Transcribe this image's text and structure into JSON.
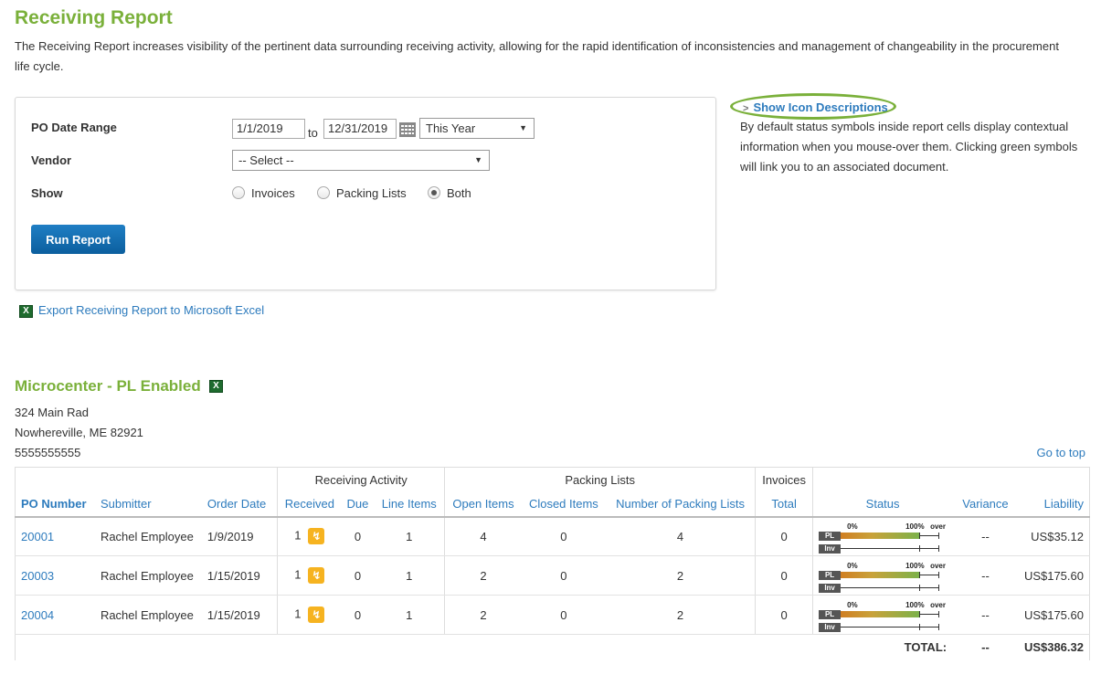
{
  "page": {
    "title": "Receiving Report",
    "description": "The Receiving Report increases visibility of the pertinent data surrounding receiving activity, allowing for the rapid identification of inconsistencies and management of changeability in the procurement life cycle."
  },
  "form": {
    "po_date_label": "PO Date Range",
    "date_from": "1/1/2019",
    "to_label": "to",
    "date_to": "12/31/2019",
    "range_preset": "This Year",
    "vendor_label": "Vendor",
    "vendor_value": "-- Select --",
    "show_label": "Show",
    "show_options": [
      "Invoices",
      "Packing Lists",
      "Both"
    ],
    "show_selected": "Both",
    "run_button": "Run Report"
  },
  "export_label": "Export Receiving Report to Microsoft Excel",
  "icon_help": {
    "link_label": "Show Icon Descriptions",
    "text": "By default status symbols inside report cells display contextual information when you mouse-over them. Clicking green symbols will link you to an associated document.",
    "highlight_color": "#7ab03a"
  },
  "vendor": {
    "name": "Microcenter - PL Enabled",
    "address_line1": "324 Main Rad",
    "address_line2": "Nowhereville, ME 82921",
    "phone": "5555555555",
    "goto_top": "Go to top"
  },
  "table": {
    "groups": {
      "receiving_activity": "Receiving Activity",
      "packing_lists": "Packing Lists",
      "invoices": "Invoices"
    },
    "columns": {
      "po_number": "PO Number",
      "submitter": "Submitter",
      "order_date": "Order Date",
      "received": "Received",
      "due": "Due",
      "line_items": "Line Items",
      "open_items": "Open Items",
      "closed_items": "Closed Items",
      "num_packing_lists": "Number of Packing Lists",
      "total": "Total",
      "status": "Status",
      "variance": "Variance",
      "liability": "Liability"
    },
    "status_bar": {
      "pl_tag": "PL",
      "inv_tag": "Inv",
      "label_0": "0%",
      "label_100": "100%",
      "label_over": "over"
    },
    "rows": [
      {
        "po": "20001",
        "submitter": "Rachel Employee",
        "order_date": "1/9/2019",
        "received": "1",
        "due": "0",
        "line_items": "1",
        "open_items": "4",
        "closed_items": "0",
        "num_pl": "4",
        "invoice_total": "0",
        "pl_progress": 1.0,
        "inv_progress": 0.0,
        "variance": "--",
        "liability": "US$35.12"
      },
      {
        "po": "20003",
        "submitter": "Rachel Employee",
        "order_date": "1/15/2019",
        "received": "1",
        "due": "0",
        "line_items": "1",
        "open_items": "2",
        "closed_items": "0",
        "num_pl": "2",
        "invoice_total": "0",
        "pl_progress": 1.0,
        "inv_progress": 0.0,
        "variance": "--",
        "liability": "US$175.60"
      },
      {
        "po": "20004",
        "submitter": "Rachel Employee",
        "order_date": "1/15/2019",
        "received": "1",
        "due": "0",
        "line_items": "1",
        "open_items": "2",
        "closed_items": "0",
        "num_pl": "2",
        "invoice_total": "0",
        "pl_progress": 1.0,
        "inv_progress": 0.0,
        "variance": "--",
        "liability": "US$175.60"
      }
    ],
    "total": {
      "label": "TOTAL:",
      "variance": "--",
      "liability": "US$386.32"
    }
  },
  "colors": {
    "brand_green": "#7ab03a",
    "link_blue": "#2d7bbd",
    "button_blue": "#1670b5",
    "receive_icon": "#f6b320"
  }
}
